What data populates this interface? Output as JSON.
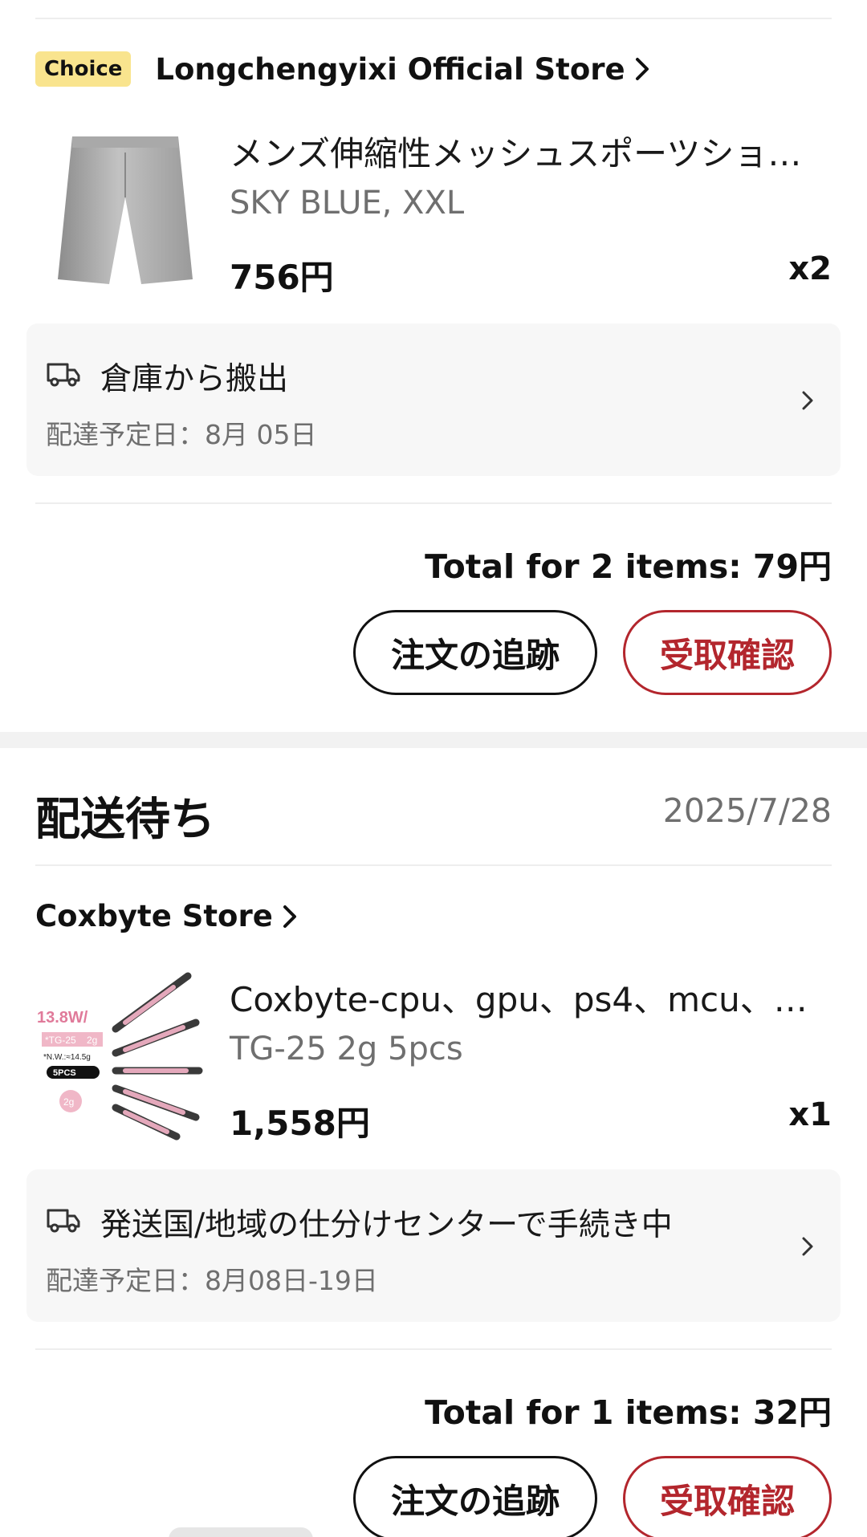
{
  "orders": [
    {
      "store": {
        "badge": "Choice",
        "name": "Longchengyixi Official Store"
      },
      "product": {
        "title": "メンズ伸縮性メッシュスポーツショ…",
        "variant": "SKY BLUE, XXL",
        "price": "756円",
        "qty": "x2",
        "image": "gray-shorts-image"
      },
      "tracking": {
        "status": "倉庫から搬出",
        "date": "配達予定日：8月 05日"
      },
      "total": "Total for 2 items: 79円",
      "buttons": {
        "track": "注文の追跡",
        "confirm": "受取確認"
      }
    },
    {
      "status": "配送待ち",
      "date": "2025/7/28",
      "store": {
        "name": "Coxbyte Store"
      },
      "product": {
        "title": "Coxbyte-cpu、gpu、ps4、mcu、ヒ…",
        "variant": "TG-25 2g 5pcs",
        "price": "1,558円",
        "qty": "x1",
        "image": "thermal-paste-syringes-image",
        "image_text": {
          "rating": "13.8W/",
          "model": "*TG-25",
          "weight_label": "2g",
          "net": "*N.W.:≈14.5g",
          "pack": "5PCS",
          "bubble": "2g"
        }
      },
      "tracking": {
        "status": "発送国/地域の仕分けセンターで手続き中",
        "date": "配達予定日：8月08日-19日"
      },
      "total": "Total for 1 items: 32円",
      "buttons": {
        "track": "注文の追跡",
        "confirm": "受取確認"
      }
    }
  ],
  "colors": {
    "accent": "#b3262d",
    "choice_badge": "#f9e48e",
    "muted": "#6f6f6f",
    "box": "#f7f7f7"
  }
}
